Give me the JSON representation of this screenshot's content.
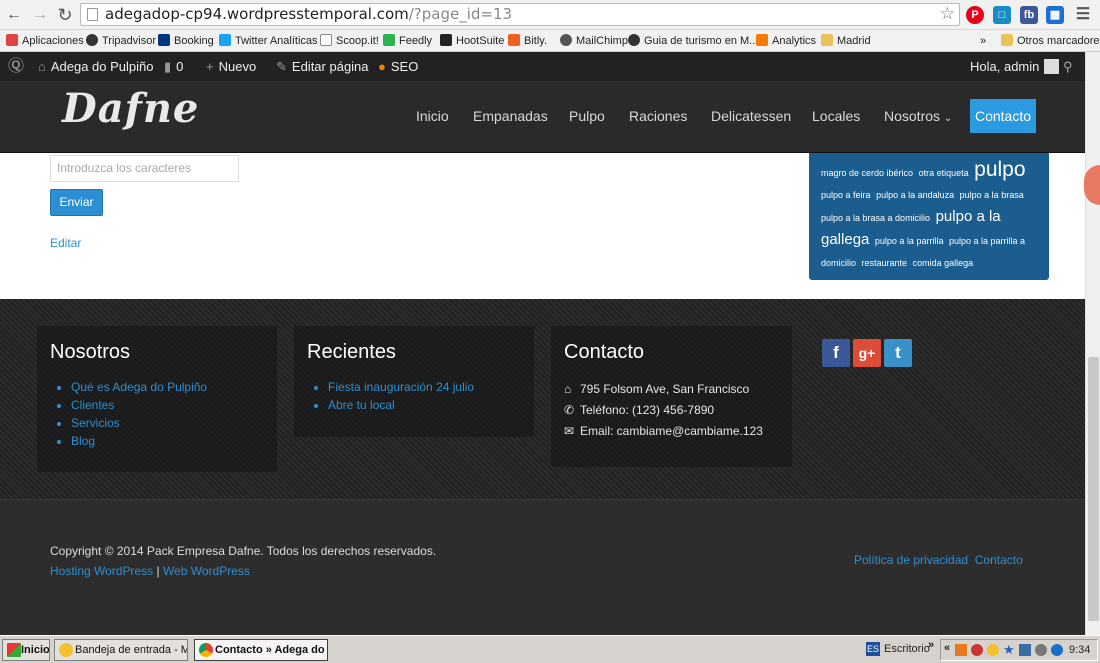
{
  "browser": {
    "url_host": "adegadop-cp94.wordpresstemporal.com",
    "url_path": "/?page_id=13",
    "bookmarks": [
      {
        "label": "Aplicaciones",
        "icon": "apps-grid-icon",
        "color": "#d44"
      },
      {
        "label": "Tripadvisor",
        "icon": "tripadvisor-icon",
        "color": "#333"
      },
      {
        "label": "Booking",
        "icon": "booking-icon",
        "color": "#003580"
      },
      {
        "label": "Twitter Analíticas",
        "icon": "twitter-icon",
        "color": "#1da1f2"
      },
      {
        "label": "Scoop.it!",
        "icon": "page-icon",
        "color": "#fff"
      },
      {
        "label": "Feedly",
        "icon": "feedly-icon",
        "color": "#2bb24c"
      },
      {
        "label": "HootSuite",
        "icon": "hootsuite-icon",
        "color": "#222"
      },
      {
        "label": "Bitly.",
        "icon": "bitly-icon",
        "color": "#ee6123"
      },
      {
        "label": "MailChimp",
        "icon": "mailchimp-icon",
        "color": "#555"
      },
      {
        "label": "Guia de turismo en M...",
        "icon": "guide-icon",
        "color": "#333"
      },
      {
        "label": "Analytics",
        "icon": "analytics-icon",
        "color": "#f57c00"
      },
      {
        "label": "Madrid",
        "icon": "folder-icon",
        "color": "#e8c25a"
      }
    ],
    "overflow_label": "»",
    "other_bookmarks": "Otros marcadores"
  },
  "adminbar": {
    "site_name": "Adega do Pulpiño",
    "comments_count": "0",
    "new_label": "Nuevo",
    "edit_label": "Editar página",
    "seo_label": "SEO",
    "greeting": "Hola, admin"
  },
  "header": {
    "logo": "Dafne",
    "nav": [
      "Inicio",
      "Empanadas",
      "Pulpo",
      "Raciones",
      "Delicatessen",
      "Locales",
      "Nosotros"
    ],
    "contact": "Contacto"
  },
  "form": {
    "captcha_placeholder": "Introduzca los caracteres",
    "submit": "Enviar",
    "edit_link": "Editar"
  },
  "tagcloud": [
    {
      "text": "magro de cerdo ibérico",
      "size": "small"
    },
    {
      "text": "otra etiqueta",
      "size": "small"
    },
    {
      "text": "pulpo",
      "size": "big"
    },
    {
      "text": "pulpo a feira",
      "size": "small"
    },
    {
      "text": "pulpo a la andaluza",
      "size": "small"
    },
    {
      "text": "pulpo a la brasa",
      "size": "small"
    },
    {
      "text": "pulpo a la brasa a domicilio",
      "size": "small"
    },
    {
      "text": "pulpo a la gallega",
      "size": "mid"
    },
    {
      "text": "pulpo a la parrilla",
      "size": "small"
    },
    {
      "text": "pulpo a la parrilla a domicilio",
      "size": "small"
    },
    {
      "text": "restaurante",
      "size": "small"
    },
    {
      "text": "comida gallega",
      "size": "small"
    }
  ],
  "footer": {
    "nosotros": {
      "title": "Nosotros",
      "links": [
        "Qué es Adega do Pulpiño",
        "Clientes",
        "Servicios",
        "Blog"
      ]
    },
    "recientes": {
      "title": "Recientes",
      "links": [
        "Fiesta inauguración 24 julio",
        "Abre tu local"
      ]
    },
    "contacto": {
      "title": "Contacto",
      "address": "795 Folsom Ave, San Francisco",
      "phone": "Teléfono: (123) 456-7890",
      "email": "Email: cambiame@cambiame.123"
    },
    "social": [
      {
        "name": "facebook",
        "glyph": "f",
        "color": "#3b5998"
      },
      {
        "name": "google-plus",
        "glyph": "g+",
        "color": "#dd4b39"
      },
      {
        "name": "twitter",
        "glyph": "t",
        "color": "#3a91c7"
      }
    ]
  },
  "bottom": {
    "copyright": "Copyright © 2014 Pack Empresa Dafne. Todos los derechos reservados.",
    "hosting": "Hosting WordPress",
    "separator": "|",
    "web": "Web WordPress",
    "privacy": "Política de privacidad",
    "contact": "Contacto"
  },
  "taskbar": {
    "start": "Inicio",
    "items": [
      "Bandeja de entrada - Mic...",
      "Contacto » Adega do ..."
    ],
    "desktop": "Escritorio",
    "desktop_arrow": "»",
    "tray_arrow": "«",
    "time": "9:34"
  },
  "colors": {
    "accent": "#2b8fd2",
    "contact_button": "#2b9ae0",
    "tagcloud_bg": "#1b5d8e"
  }
}
